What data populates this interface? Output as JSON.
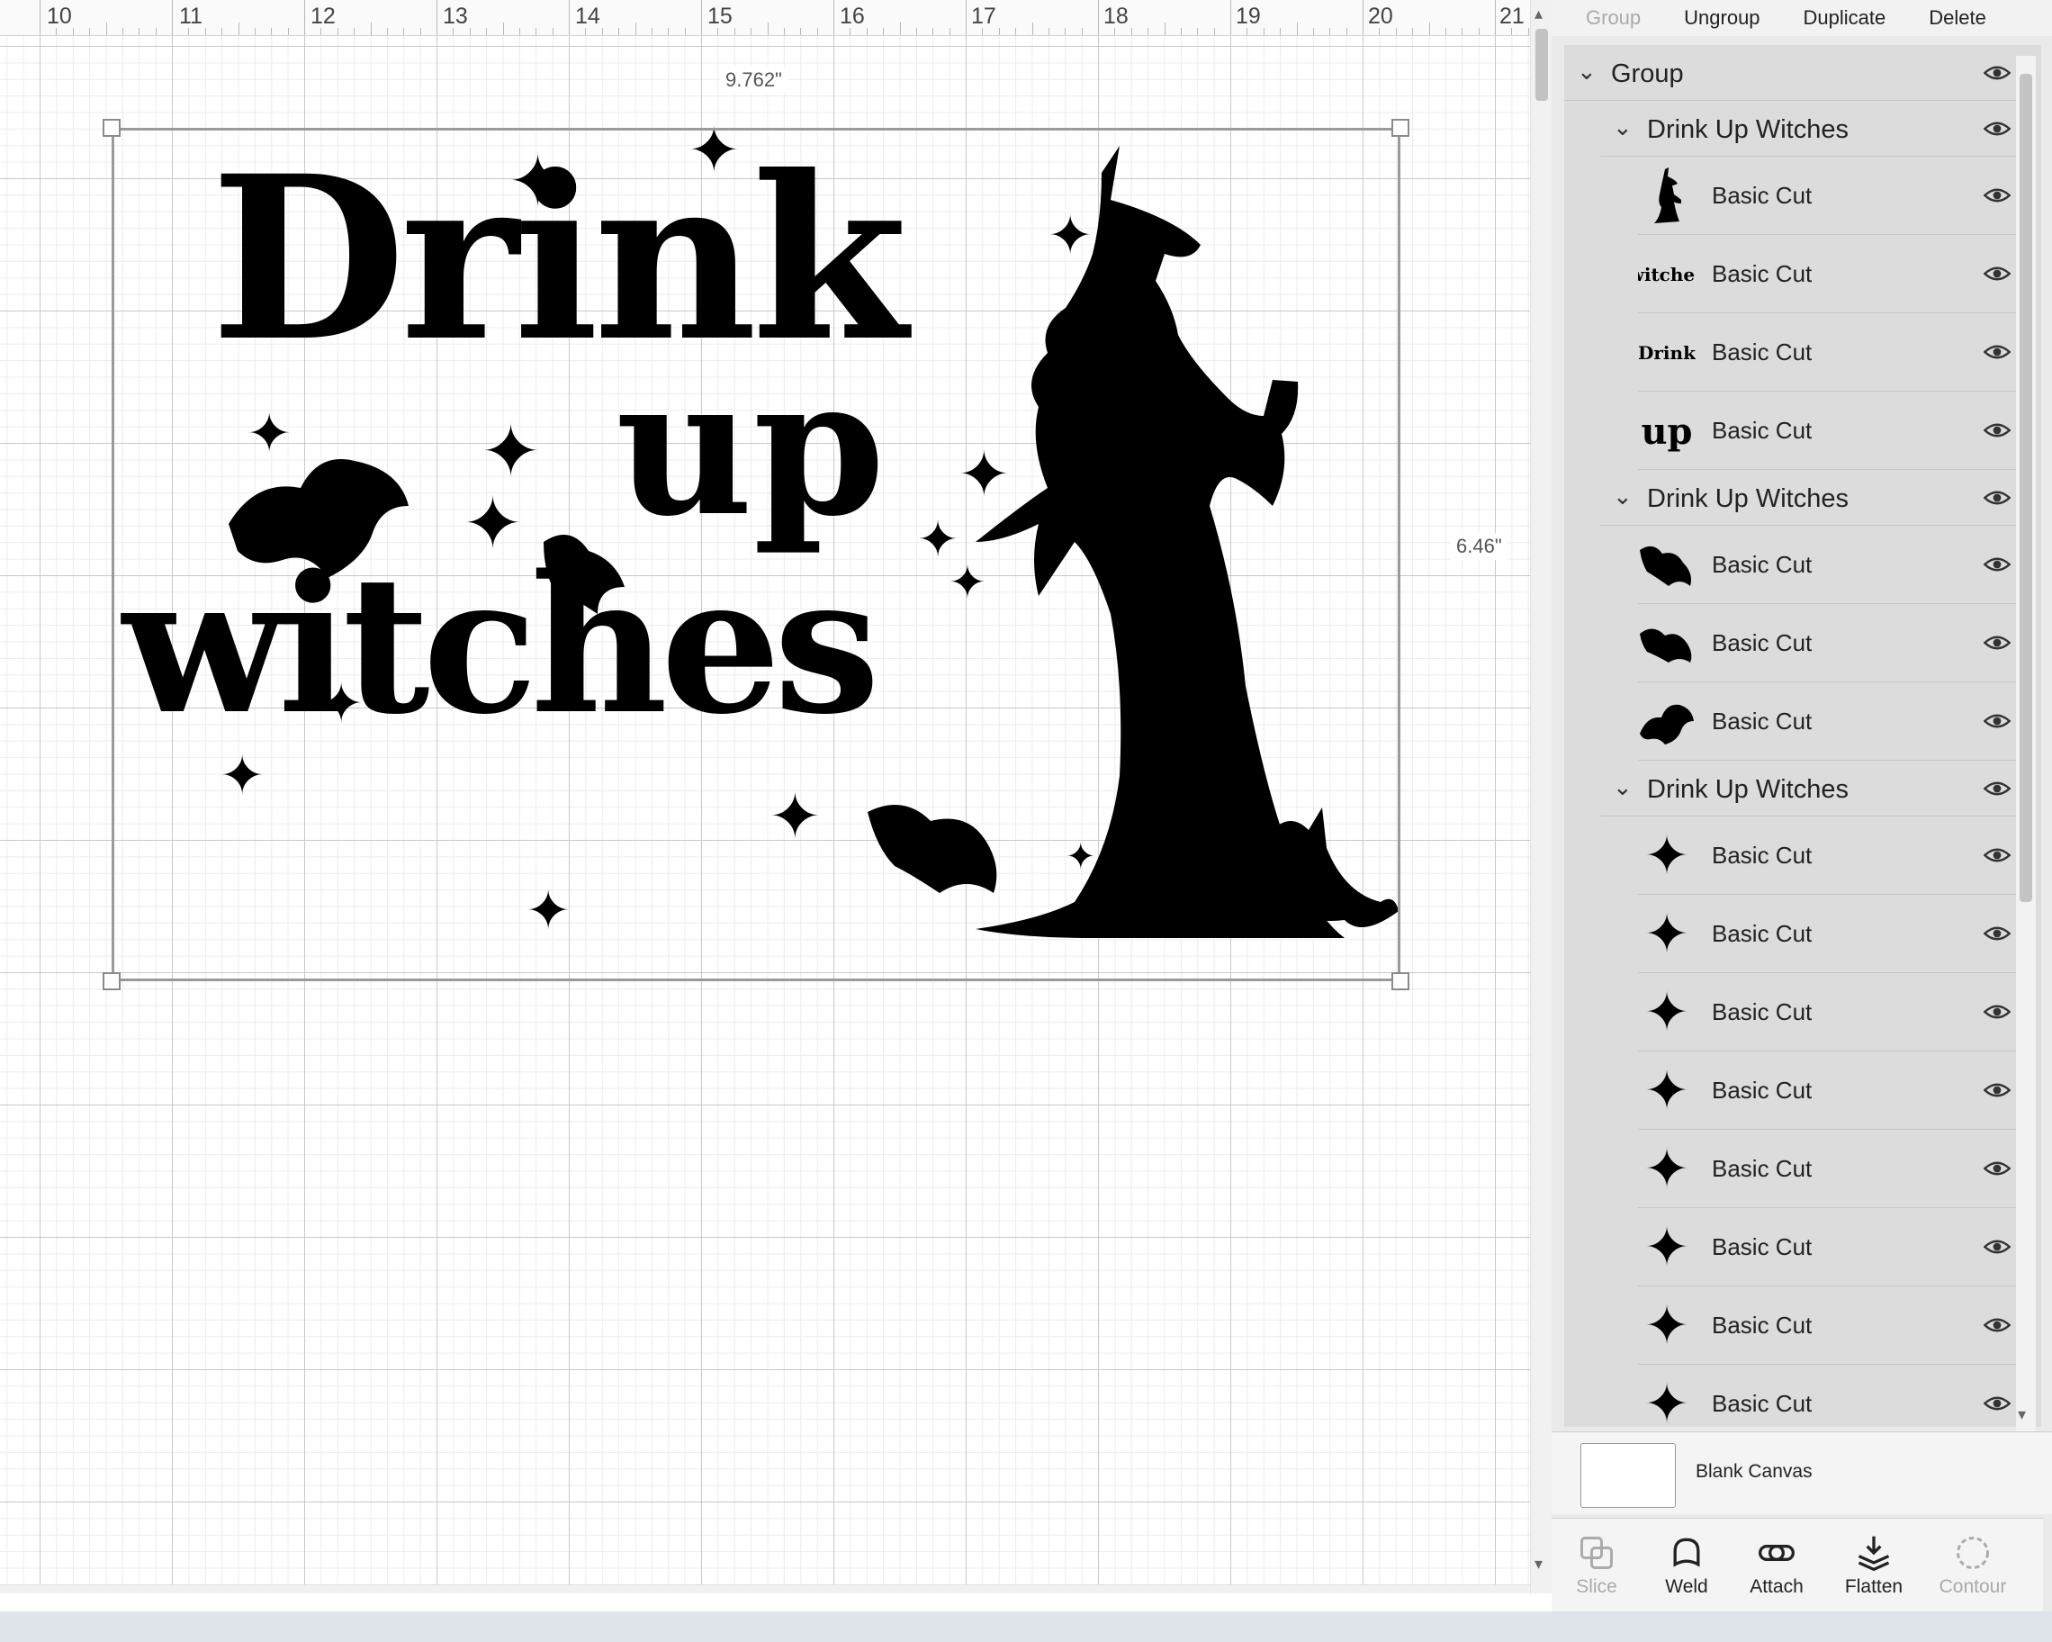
{
  "ruler": {
    "numbers": [
      "10",
      "11",
      "12",
      "13",
      "14",
      "15",
      "16",
      "17",
      "18",
      "19",
      "20",
      "21"
    ]
  },
  "canvas": {
    "width_label": "9.762\"",
    "height_label": "6.46\"",
    "artwork": {
      "word1": "Drink",
      "word2": "up",
      "word3": "witches"
    }
  },
  "layers_toolbar": {
    "group": "Group",
    "ungroup": "Ungroup",
    "duplicate": "Duplicate",
    "delete": "Delete"
  },
  "layers": {
    "root": "Group",
    "groups": [
      {
        "name": "Drink Up Witches",
        "items": [
          {
            "label": "Basic Cut",
            "thumb": "witch-silhouette"
          },
          {
            "label": "Basic Cut",
            "thumb": "witches-text"
          },
          {
            "label": "Basic Cut",
            "thumb": "drink-text"
          },
          {
            "label": "Basic Cut",
            "thumb": "up-text"
          }
        ]
      },
      {
        "name": "Drink Up Witches",
        "items": [
          {
            "label": "Basic Cut",
            "thumb": "bat"
          },
          {
            "label": "Basic Cut",
            "thumb": "bat"
          },
          {
            "label": "Basic Cut",
            "thumb": "bat"
          }
        ]
      },
      {
        "name": "Drink Up Witches",
        "items": [
          {
            "label": "Basic Cut",
            "thumb": "sparkle"
          },
          {
            "label": "Basic Cut",
            "thumb": "sparkle"
          },
          {
            "label": "Basic Cut",
            "thumb": "sparkle"
          },
          {
            "label": "Basic Cut",
            "thumb": "sparkle"
          },
          {
            "label": "Basic Cut",
            "thumb": "sparkle"
          },
          {
            "label": "Basic Cut",
            "thumb": "sparkle"
          },
          {
            "label": "Basic Cut",
            "thumb": "sparkle"
          },
          {
            "label": "Basic Cut",
            "thumb": "sparkle"
          }
        ]
      }
    ],
    "thumb_text": {
      "witches": "witches",
      "drink": "Drink",
      "up": "up"
    }
  },
  "blank_canvas": {
    "label": "Blank Canvas"
  },
  "actions": {
    "slice": "Slice",
    "weld": "Weld",
    "attach": "Attach",
    "flatten": "Flatten",
    "contour": "Contour"
  },
  "icons": {
    "chevron": "chevron-down-icon",
    "visibility": "eye-icon"
  }
}
